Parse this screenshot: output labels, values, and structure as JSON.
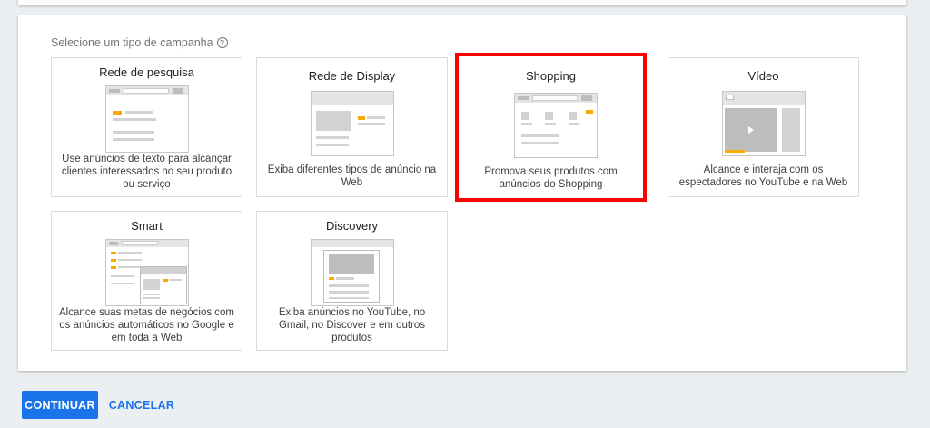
{
  "section": {
    "label": "Selecione um tipo de campanha",
    "help_icon": "help-circle-icon"
  },
  "tiles": [
    {
      "title": "Rede de pesquisa",
      "description": "Use anúncios de texto para alcançar clientes interessados no seu produto ou serviço",
      "selected": false
    },
    {
      "title": "Rede de Display",
      "description": "Exiba diferentes tipos de anúncio na Web",
      "selected": false
    },
    {
      "title": "Shopping",
      "description": "Promova seus produtos com anúncios do Shopping",
      "selected": true
    },
    {
      "title": "Vídeo",
      "description": "Alcance e interaja com os espectadores no YouTube e na Web",
      "selected": false
    },
    {
      "title": "Smart",
      "description": "Alcance suas metas de negócios com os anúncios automáticos no Google e em toda a Web",
      "selected": false
    },
    {
      "title": "Discovery",
      "description": "Exiba anúncios no YouTube, no Gmail, no Discover e em outros produtos",
      "selected": false
    }
  ],
  "footer": {
    "continue_label": "CONTINUAR",
    "cancel_label": "CANCELAR"
  },
  "colors": {
    "primary": "#1a73e8",
    "selection": "#ff0000",
    "ad_highlight": "#f9ab00"
  }
}
